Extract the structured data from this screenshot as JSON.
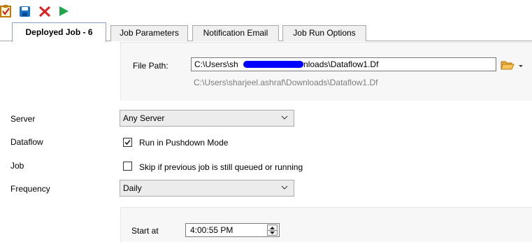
{
  "toolbar": {
    "buttons": [
      {
        "name": "clipboard-check-icon",
        "color": "#d28a1e"
      },
      {
        "name": "save-icon",
        "color": "#1a6fc9"
      },
      {
        "name": "close-icon",
        "color": "#e02020"
      },
      {
        "name": "run-icon",
        "color": "#22a64a"
      }
    ]
  },
  "tabs": [
    {
      "label": "Deployed Job - 6",
      "active": true
    },
    {
      "label": "Job Parameters",
      "active": false
    },
    {
      "label": "Notification Email",
      "active": false
    },
    {
      "label": "Job Run Options",
      "active": false
    }
  ],
  "file_path": {
    "label": "File Path:",
    "value_prefix": "C:\\Users\\sh",
    "value_suffix": "\\Downloads\\Dataflow1.Df",
    "resolved_hint": "C:\\Users\\sharjeel.ashraf\\Downloads\\Dataflow1.Df"
  },
  "form": {
    "server_label": "Server",
    "server_value": "Any Server",
    "dataflow_label": "Dataflow",
    "pushdown_label": "Run in Pushdown Mode",
    "pushdown_checked": true,
    "job_label": "Job",
    "skip_label": "Skip if previous job is still queued or running",
    "skip_checked": false,
    "frequency_label": "Frequency",
    "frequency_value": "Daily"
  },
  "schedule": {
    "start_label": "Start at",
    "start_value": "4:00:55 PM"
  }
}
